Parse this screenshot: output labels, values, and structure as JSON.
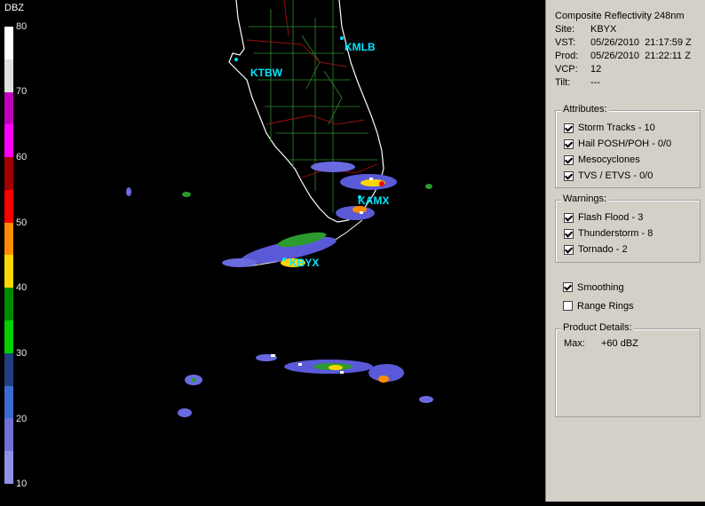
{
  "legend": {
    "unit": "DBZ",
    "ticks": [
      "80",
      "70",
      "60",
      "50",
      "40",
      "30",
      "20",
      "10"
    ],
    "colors": [
      "#ffffff",
      "#e0e0e0",
      "#c000c0",
      "#ff00ff",
      "#a00000",
      "#ff0000",
      "#ff8c00",
      "#ffd700",
      "#008c00",
      "#00d000",
      "#204080",
      "#3c6cd0",
      "#7070d8",
      "#9090e8"
    ]
  },
  "map": {
    "sites": [
      {
        "label": "KMLB"
      },
      {
        "label": "KTBW"
      },
      {
        "label": "KAMX"
      },
      {
        "label": "KBYX"
      }
    ]
  },
  "panel": {
    "product": "Composite Reflectivity 248nm",
    "site_key": "Site:",
    "site_val": "KBYX",
    "vst_key": "VST:",
    "vst_val": "05/26/2010  21:17:59 Z",
    "prod_key": "Prod:",
    "prod_val": "05/26/2010  21:22:11 Z",
    "vcp_key": "VCP:",
    "vcp_val": "12",
    "tilt_key": "Tilt:",
    "tilt_val": "---",
    "attributes_title": "Attributes:",
    "attributes": [
      "Storm Tracks - 10",
      "Hail POSH/POH - 0/0",
      "Mesocyclones",
      "TVS / ETVS - 0/0"
    ],
    "warnings_title": "Warnings:",
    "warnings": [
      "Flash Flood - 3",
      "Thunderstorm - 8",
      "Tornado - 2"
    ],
    "smoothing": "Smoothing",
    "range_rings": "Range Rings",
    "details_title": "Product Details:",
    "max_key": "Max:",
    "max_val": "+60 dBZ"
  }
}
